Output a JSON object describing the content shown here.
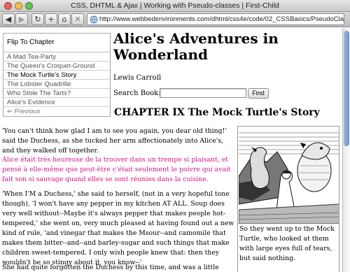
{
  "window": {
    "title": "CSS, DHTML & Ajax | Working with Pseudo-classes | First-Child",
    "url": "http://www.webbedenvironments.com/dhtml/css4e/code/02_CSSBasics/PseudoClassLa"
  },
  "toolbar": {
    "back_icon": "back-arrow-icon",
    "forward_icon": "forward-arrow-icon",
    "reload_icon": "reload-icon",
    "add_icon": "plus-icon",
    "home_icon": "home-icon",
    "stop_icon": "stop-icon"
  },
  "nav": {
    "title": "Flip To Chapter",
    "items": [
      "A Mad Tea-Party",
      "The Queen's Croquet-Ground",
      "The Mock Turtle's Story",
      "The Lobster Quadrille",
      "Who Stole The Tarts?",
      "Alice's Evidence"
    ],
    "current_index": 2,
    "previous": "Previous",
    "previous_arrow": "⇐"
  },
  "book": {
    "title": "Alice's Adventures in Wonderland",
    "author": "Lewis Carroll"
  },
  "search": {
    "label": "Search Book:",
    "value": "",
    "button": "Find"
  },
  "chapter": {
    "heading": "CHAPTER IX The Mock Turtle's Story",
    "paragraphs": [
      "'You can't think how glad I am to see you again, you dear old thing!' said the Duchess, as she tucked her arm affectionately into Alice's, and they walked off together.",
      "Alice était très heureuse de la trouver dans un trempe si plaisant, et pensé à elle-même que peut-être c'était seulement le poivre qui avait fait son si sauvage quand elles se sont réunies dans la cuisine.",
      "'When I'M a Duchess,' she said to herself, (not in a very hopeful tone though), 'I won't have any pepper in my kitchen AT ALL. Soup does very well without--Maybe it's always pepper that makes people hot-tempered,' she went on, very much pleased at having found out a new kind of rule, 'and vinegar that makes the Msour--and camomile that makes them bitter--and--and barley-sugar and such things that make children sweet-tempered. I only wish people knew that: then they wouldn't be so stingy about it, you know--'",
      "She had quite forgotten the Duchess by this time, and was a little startled"
    ],
    "caption": "So they went up to the Mock Turtle, who looked at them with large eyes full of tears, but said nothing."
  },
  "colors": {
    "french_text": "#d0148d",
    "scroll_thumb": "#6f93c9"
  }
}
